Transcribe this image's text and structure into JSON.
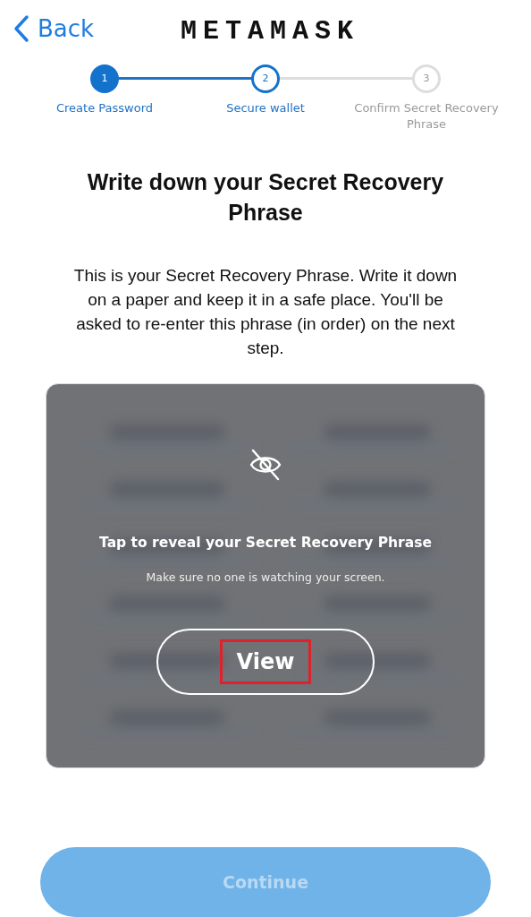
{
  "header": {
    "back": "Back",
    "logo": "METAMASK"
  },
  "steps": [
    {
      "number": "1",
      "label": "Create Password",
      "done": true,
      "selected": false
    },
    {
      "number": "2",
      "label": "Secure wallet",
      "done": false,
      "selected": true
    },
    {
      "number": "3",
      "label": "Confirm Secret Recovery Phrase",
      "done": false,
      "selected": false
    }
  ],
  "title": "Write down your Secret Recovery Phrase",
  "description": "This is your Secret Recovery Phrase. Write it down on a paper and keep it in a safe place. You'll be asked to re-enter this phrase (in order) on the next step.",
  "reveal_card": {
    "heading": "Tap to reveal your Secret Recovery Phrase",
    "note": "Make sure no one is watching your screen.",
    "button": {
      "label": "View",
      "highlighted": true
    }
  },
  "continue_button": {
    "label": "Continue",
    "disabled": true
  }
}
